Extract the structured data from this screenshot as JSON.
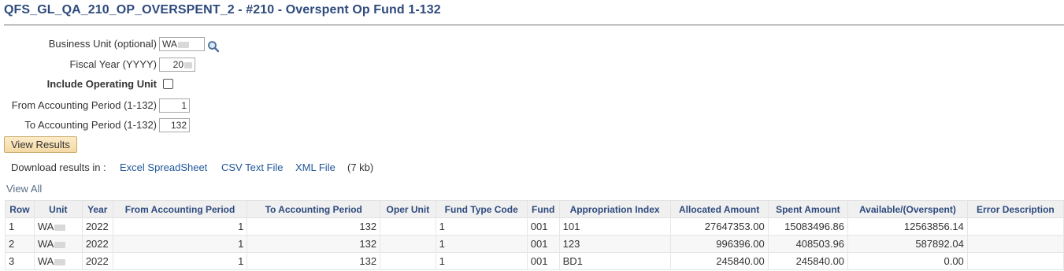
{
  "page": {
    "title": "QFS_GL_QA_210_OP_OVERSPENT_2 - #210 - Overspent Op Fund 1-132"
  },
  "form": {
    "business_unit_label": "Business Unit (optional)",
    "business_unit_value": "WA",
    "fiscal_year_label": "Fiscal Year (YYYY)",
    "fiscal_year_value": "20",
    "include_operating_unit_label": "Include Operating Unit",
    "include_operating_unit_checked": false,
    "from_period_label": "From Accounting Period (1-132)",
    "from_period_value": "1",
    "to_period_label": "To Accounting Period (1-132)",
    "to_period_value": "132",
    "view_results_label": "View Results"
  },
  "download": {
    "prefix": "Download results in :",
    "excel": "Excel SpreadSheet",
    "csv": "CSV Text File",
    "xml": "XML File",
    "size": "(7 kb)"
  },
  "view_all": "View All",
  "table": {
    "headers": [
      "Row",
      "Unit",
      "Year",
      "From Accounting Period",
      "To Accounting Period",
      "Oper Unit",
      "Fund Type Code",
      "Fund",
      "Appropriation Index",
      "Allocated Amount",
      "Spent Amount",
      "Available/(Overspent)",
      "Error Description"
    ],
    "rows": [
      {
        "row": "1",
        "unit": "WA",
        "year": "2022",
        "from": "1",
        "to": "132",
        "oper": "",
        "fund_type": "1",
        "fund": "001",
        "approp": "101",
        "allocated": "27647353.00",
        "spent": "15083496.86",
        "available": "12563856.14",
        "error": ""
      },
      {
        "row": "2",
        "unit": "WA",
        "year": "2022",
        "from": "1",
        "to": "132",
        "oper": "",
        "fund_type": "1",
        "fund": "001",
        "approp": "123",
        "allocated": "996396.00",
        "spent": "408503.96",
        "available": "587892.04",
        "error": ""
      },
      {
        "row": "3",
        "unit": "WA",
        "year": "2022",
        "from": "1",
        "to": "132",
        "oper": "",
        "fund_type": "1",
        "fund": "001",
        "approp": "BD1",
        "allocated": "245840.00",
        "spent": "245840.00",
        "available": "0.00",
        "error": ""
      }
    ]
  }
}
